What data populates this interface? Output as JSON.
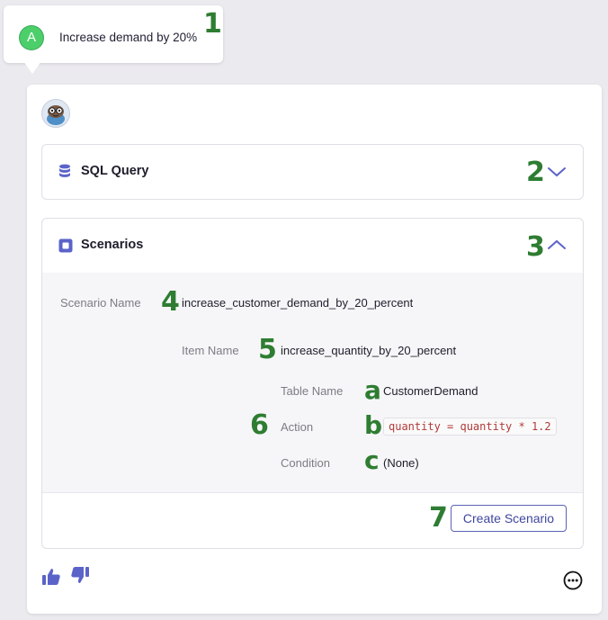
{
  "user_message": {
    "avatar_letter": "A",
    "text": "Increase demand by 20%"
  },
  "annotations": {
    "n1": "1",
    "n2": "2",
    "n3": "3",
    "n4": "4",
    "n5": "5",
    "n6": "6",
    "n7": "7",
    "a": "a",
    "b": "b",
    "c": "c"
  },
  "sql_panel": {
    "title": "SQL Query",
    "icon": "database-icon",
    "state": "collapsed"
  },
  "scenarios_panel": {
    "title": "Scenarios",
    "icon": "square-icon",
    "state": "expanded",
    "scenario_name_label": "Scenario Name",
    "scenario_name": "increase_customer_demand_by_20_percent",
    "item_name_label": "Item Name",
    "item_name": "increase_quantity_by_20_percent",
    "table_name_label": "Table Name",
    "table_name": "CustomerDemand",
    "action_label": "Action",
    "action": "quantity = quantity * 1.2",
    "condition_label": "Condition",
    "condition": "(None)",
    "create_button": "Create Scenario"
  },
  "footer": {
    "thumbs_up_icon": "thumbs-up-icon",
    "thumbs_down_icon": "thumbs-down-icon",
    "more_icon": "more-options-icon"
  },
  "colors": {
    "accent": "#5b63c9",
    "annotation": "#2e7d32",
    "avatar_green": "#4ccf6a"
  }
}
